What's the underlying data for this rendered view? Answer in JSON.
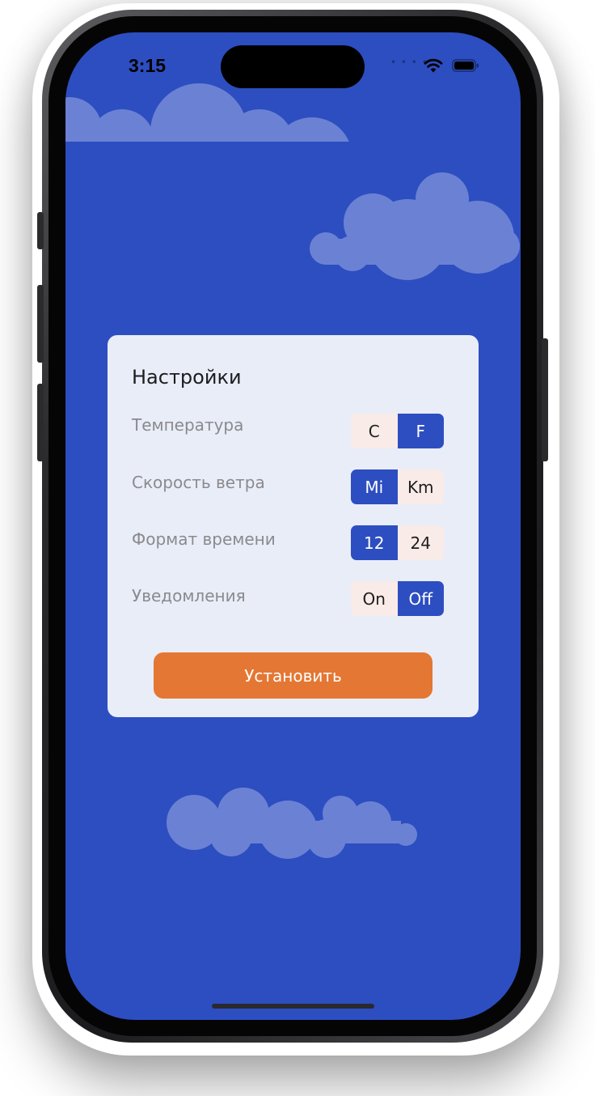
{
  "status_bar": {
    "time": "3:15",
    "signal_icon": "signal-dots-icon",
    "wifi_icon": "wifi-icon",
    "battery_icon": "battery-icon"
  },
  "settings": {
    "title": "Настройки",
    "rows": [
      {
        "label": "Температура",
        "options": [
          "C",
          "F"
        ],
        "selected": "F"
      },
      {
        "label": "Скорость ветра",
        "options": [
          "Mi",
          "Km"
        ],
        "selected": "Mi"
      },
      {
        "label": "Формат времени",
        "options": [
          "12",
          "24"
        ],
        "selected": "12"
      },
      {
        "label": "Уведомления",
        "options": [
          "On",
          "Off"
        ],
        "selected": "Off"
      }
    ],
    "submit_label": "Установить"
  },
  "colors": {
    "background": "#2d4ec1",
    "card": "#e9edf8",
    "accent_selected": "#2d4ec1",
    "option_unselected": "#f9ebe7",
    "button": "#e47733",
    "cloud": "#6b82d4"
  }
}
